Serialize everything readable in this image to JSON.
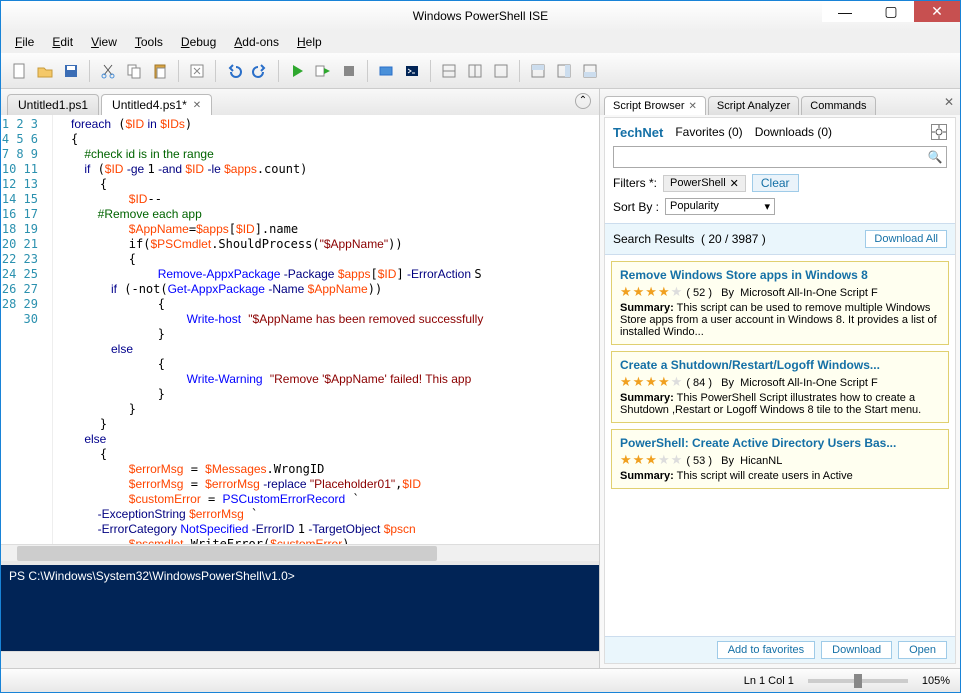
{
  "window": {
    "title": "Windows PowerShell ISE"
  },
  "menu": {
    "file": "File",
    "edit": "Edit",
    "view": "View",
    "tools": "Tools",
    "debug": "Debug",
    "addons": "Add-ons",
    "help": "Help"
  },
  "tabs": {
    "t1": "Untitled1.ps1",
    "t2": "Untitled4.ps1*"
  },
  "lines": [
    "1",
    "2",
    "3",
    "4",
    "5",
    "6",
    "7",
    "8",
    "9",
    "10",
    "11",
    "12",
    "13",
    "14",
    "15",
    "16",
    "17",
    "18",
    "19",
    "20",
    "21",
    "22",
    "23",
    "24",
    "25",
    "26",
    "27",
    "28",
    "29",
    "30"
  ],
  "console": {
    "prompt": "PS C:\\Windows\\System32\\WindowsPowerShell\\v1.0>"
  },
  "right_tabs": {
    "browser": "Script Browser",
    "analyzer": "Script Analyzer",
    "commands": "Commands"
  },
  "browser": {
    "brand": "TechNet",
    "favorites": "Favorites (0)",
    "downloads": "Downloads (0)",
    "filters_label": "Filters *:",
    "filter_chip": "PowerShell",
    "clear": "Clear",
    "sortby": "Sort By :",
    "sort_value": "Popularity",
    "results_label": "Search Results",
    "results_count": "( 20 / 3987 )",
    "download_all": "Download All"
  },
  "results": [
    {
      "title": "Remove Windows Store apps in Windows 8",
      "rating": 4,
      "count": "( 52 )",
      "by": "By",
      "author": "Microsoft All-In-One Script F",
      "summary_label": "Summary:",
      "summary": "This script can be used to remove multiple Windows Store apps from a user account in Windows 8. It provides a list of installed Windo..."
    },
    {
      "title": "Create a Shutdown/Restart/Logoff Windows...",
      "rating": 4,
      "count": "( 84 )",
      "by": "By",
      "author": "Microsoft All-In-One Script F",
      "summary_label": "Summary:",
      "summary": "This PowerShell Script illustrates how to create a Shutdown ,Restart or Logoff Windows 8 tile to the Start menu."
    },
    {
      "title": "PowerShell: Create Active Directory Users Bas...",
      "rating": 3,
      "count": "( 53 )",
      "by": "By",
      "author": "HicanNL",
      "summary_label": "Summary:",
      "summary": "This script will create users in Active"
    }
  ],
  "actions": {
    "fav": "Add to favorites",
    "download": "Download",
    "open": "Open"
  },
  "status": {
    "pos": "Ln 1  Col 1",
    "zoom": "105%"
  },
  "code": {
    "l1a": "foreach",
    "l1b": " (",
    "l1c": "$ID",
    "l1d": " in ",
    "l1e": "$IDs",
    "l1f": ")",
    "l2": "{",
    "l3": "    #check id is in the range",
    "l4a": "    if",
    "l4b": " (",
    "l4c": "$ID",
    "l4d": " -ge ",
    "l4e": "1",
    "l4f": " -and ",
    "l4g": "$ID",
    "l4h": " -le ",
    "l4i": "$apps",
    "l4j": ".count)",
    "l5": "    {",
    "l6a": "        ",
    "l6b": "$ID",
    "l6c": "--",
    "l7": "        #Remove each app",
    "l8a": "        ",
    "l8b": "$AppName",
    "l8c": "=",
    "l8d": "$apps",
    "l8e": "[",
    "l8f": "$ID",
    "l8g": "].name",
    "l9a": "        if(",
    "l9b": "$PSCmdlet",
    "l9c": ".ShouldProcess(",
    "l9d": "\"$AppName\"",
    "l9e": "))",
    "l10": "        {",
    "l11a": "            ",
    "l11b": "Remove-AppxPackage",
    "l11c": " -Package ",
    "l11d": "$apps",
    "l11e": "[",
    "l11f": "$ID",
    "l11g": "]",
    "l11h": " -ErrorAction ",
    "l11i": "S",
    "l12a": "            if",
    "l12b": " (-not(",
    "l12c": "Get-AppxPackage",
    "l12d": " -Name ",
    "l12e": "$AppName",
    "l12f": "))",
    "l13": "            {",
    "l14a": "                ",
    "l14b": "Write-host",
    "l14c": " ",
    "l14d": "\"$AppName has been removed successfully",
    "l15": "            }",
    "l16": "            else",
    "l17": "            {",
    "l18a": "                ",
    "l18b": "Write-Warning",
    "l18c": " ",
    "l18d": "\"Remove '$AppName' failed! This app",
    "l19": "            }",
    "l20": "        }",
    "l21": "    }",
    "l22": "    else",
    "l23": "    {",
    "l24a": "        ",
    "l24b": "$errorMsg",
    "l24c": " = ",
    "l24d": "$Messages",
    "l24e": ".WrongID",
    "l25a": "        ",
    "l25b": "$errorMsg",
    "l25c": " = ",
    "l25d": "$errorMsg",
    "l25e": " -replace ",
    "l25f": "\"Placeholder01\"",
    "l25g": ",",
    "l25h": "$ID",
    "l26a": "        ",
    "l26b": "$customError",
    "l26c": " = ",
    "l26d": "PSCustomErrorRecord",
    "l26e": " `",
    "l27a": "        -ExceptionString ",
    "l27b": "$errorMsg",
    "l27c": " `",
    "l28a": "        -ErrorCategory ",
    "l28b": "NotSpecified",
    "l28c": " -ErrorID ",
    "l28d": "1",
    "l28e": " -TargetObject ",
    "l28f": "$pscn",
    "l29a": "        ",
    "l29b": "$pscmdlet",
    "l29c": ".WriteError(",
    "l29d": "$customError",
    "l29e": ")",
    "l30": "    }"
  }
}
